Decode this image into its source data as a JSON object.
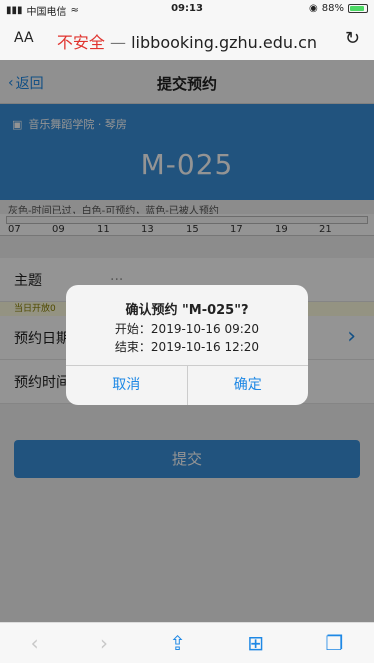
{
  "status_bar": {
    "carrier": "中国电信",
    "time": "09:13",
    "battery": "88%",
    "battery_level": 0.88
  },
  "browser": {
    "text_size": "AA",
    "insecure_label": "不安全",
    "separator": "—",
    "domain": "libbooking.gzhu.edu.cn"
  },
  "nav": {
    "back_label": "返回",
    "title": "提交预约"
  },
  "room": {
    "info": "音乐舞蹈学院 · 琴房",
    "name": "M-025"
  },
  "legend": "灰色-时间已过，白色-可预约，蓝色-已被人预约",
  "timeline": {
    "ticks": [
      "07",
      "09",
      "11",
      "13",
      "15",
      "17",
      "19",
      "21"
    ]
  },
  "form": {
    "subject_label": "主题",
    "subject_value": "...",
    "note": "当日开放0",
    "date_label": "预约日期",
    "time_label": "预约时间"
  },
  "submit_label": "提交",
  "dialog": {
    "title": "确认预约 \"M-025\"?",
    "start": "开始：2019-10-16 09:20",
    "end": "结束：2019-10-16 12:20",
    "cancel": "取消",
    "confirm": "确定"
  },
  "colors": {
    "accent": "#1e88e5",
    "header": "#3a8fd9",
    "insecure": "#e0332e"
  },
  "icons": [
    "wifi-icon",
    "lock-icon",
    "reload-icon",
    "back-chevron-icon",
    "room-icon",
    "chevron-right-icon",
    "toolbar-back-icon",
    "toolbar-forward-icon",
    "share-icon",
    "bookmarks-icon",
    "tabs-icon"
  ]
}
